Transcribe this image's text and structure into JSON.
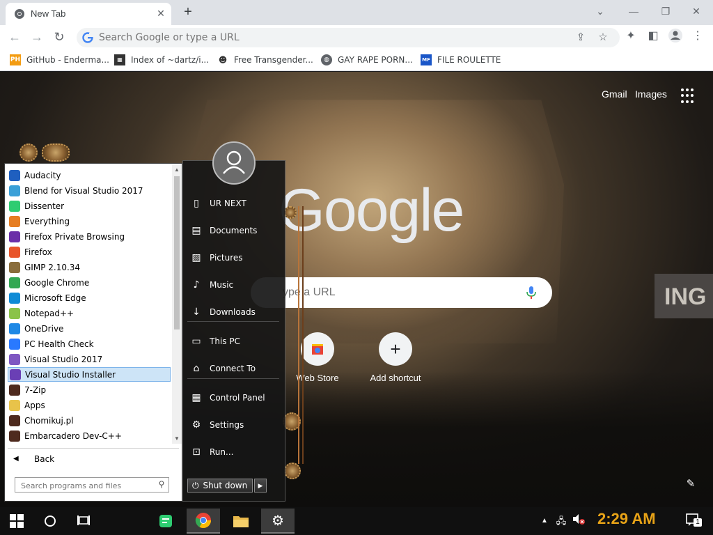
{
  "browser": {
    "tab_title": "New Tab",
    "omnibox_placeholder": "Search Google or type a URL",
    "bookmarks": [
      {
        "label": "GitHub - Enderma...",
        "icon": "PH",
        "color": "#f39c12"
      },
      {
        "label": "Index of ~dartz/i...",
        "icon": "grid",
        "color": "#333333"
      },
      {
        "label": "Free Transgender...",
        "icon": "mask",
        "color": "#555555"
      },
      {
        "label": "GAY RAPE PORN...",
        "icon": "globe",
        "color": "#5f6368"
      },
      {
        "label": "FILE ROULETTE",
        "icon": "MF",
        "color": "#1a56c8"
      }
    ]
  },
  "ntp": {
    "gmail": "Gmail",
    "images": "Images",
    "logo": "Google",
    "search_placeholder": "ype a URL",
    "shortcuts": [
      {
        "label": "Web Store"
      },
      {
        "label": "Add shortcut"
      }
    ],
    "sign_text": "ING"
  },
  "start_menu": {
    "programs": [
      {
        "label": "Audacity",
        "color": "#1f5fbf"
      },
      {
        "label": "Blend for Visual Studio 2017",
        "color": "#3aa0d8"
      },
      {
        "label": "Dissenter",
        "color": "#2ecc71"
      },
      {
        "label": "Everything",
        "color": "#e67e22"
      },
      {
        "label": "Firefox Private Browsing",
        "color": "#6b2fa8"
      },
      {
        "label": "Firefox",
        "color": "#e8552a"
      },
      {
        "label": "GIMP 2.10.34",
        "color": "#8a6d3b"
      },
      {
        "label": "Google Chrome",
        "color": "#34a853"
      },
      {
        "label": "Microsoft Edge",
        "color": "#0f8bd6"
      },
      {
        "label": "Notepad++",
        "color": "#8bc34a"
      },
      {
        "label": "OneDrive",
        "color": "#1e88e5"
      },
      {
        "label": "PC Health Check",
        "color": "#2979ff"
      },
      {
        "label": "Visual Studio 2017",
        "color": "#7e57c2"
      },
      {
        "label": "Visual Studio Installer",
        "color": "#6a3fb5"
      },
      {
        "label": "7-Zip",
        "color": "#4e2a1e"
      },
      {
        "label": "Apps",
        "color": "#e8c34a"
      },
      {
        "label": "Chomikuj.pl",
        "color": "#4e2a1e"
      },
      {
        "label": "Embarcadero Dev-C++",
        "color": "#4e2a1e"
      }
    ],
    "selected_index": 13,
    "back_label": "Back",
    "search_placeholder": "Search programs and files",
    "right_items": [
      {
        "label": "UR NEXT",
        "icon": "folder-icon"
      },
      {
        "label": "Documents",
        "icon": "documents-icon"
      },
      {
        "label": "Pictures",
        "icon": "pictures-icon"
      },
      {
        "label": "Music",
        "icon": "music-icon"
      },
      {
        "label": "Downloads",
        "icon": "downloads-icon"
      },
      {
        "label": "This PC",
        "icon": "computer-icon"
      },
      {
        "label": "Connect To",
        "icon": "connect-icon"
      },
      {
        "label": "Control Panel",
        "icon": "control-panel-icon"
      },
      {
        "label": "Settings",
        "icon": "gear-icon"
      },
      {
        "label": "Run...",
        "icon": "run-icon"
      }
    ],
    "shutdown_label": "Shut down"
  },
  "taskbar": {
    "clock": "2:29 AM",
    "notification_count": "1"
  }
}
